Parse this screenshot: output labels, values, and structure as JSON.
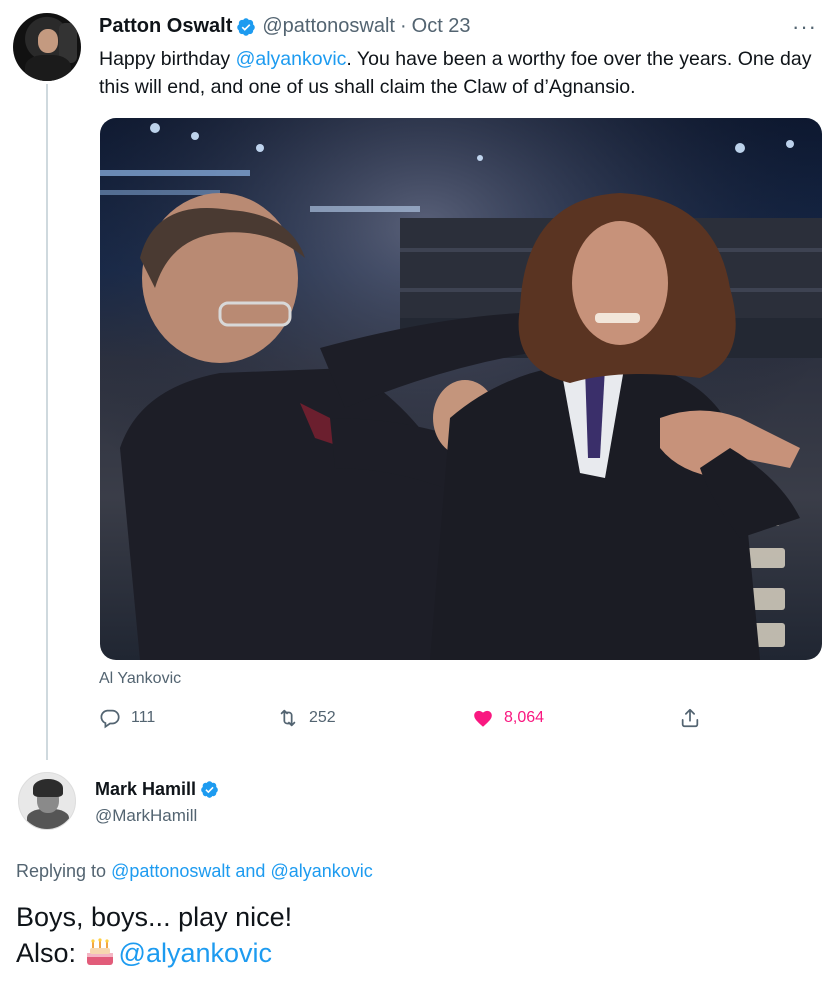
{
  "tweet": {
    "author_name": "Patton Oswalt",
    "author_handle": "@pattonoswalt",
    "separator": "·",
    "date": "Oct 23",
    "more_label": "···",
    "text_lead": "Happy birthday ",
    "text_mention": "@alyankovic",
    "text_rest": ". You have been a worthy foe over the years. One day this will end, and one of us shall claim the Claw of d’Agnansio.",
    "photo_caption": "Al Yankovic",
    "replies": "111",
    "retweets": "252",
    "likes": "8,064"
  },
  "reply": {
    "author_name": "Mark Hamill",
    "author_handle": "@MarkHamill",
    "replying_prefix": "Replying to ",
    "replying_to_1": "@pattonoswalt",
    "replying_and": " and ",
    "replying_to_2": "@alyankovic",
    "line1": "Boys, boys... play nice!",
    "line2_prefix": "Also: ",
    "line2_mention": "@alyankovic"
  },
  "colors": {
    "accent": "#1d9bf0",
    "like": "#f91880",
    "muted": "#536471"
  },
  "icons": [
    "verified-badge-icon",
    "more-icon",
    "reply-icon",
    "retweet-icon",
    "heart-icon",
    "share-icon",
    "birthday-cake-icon"
  ]
}
